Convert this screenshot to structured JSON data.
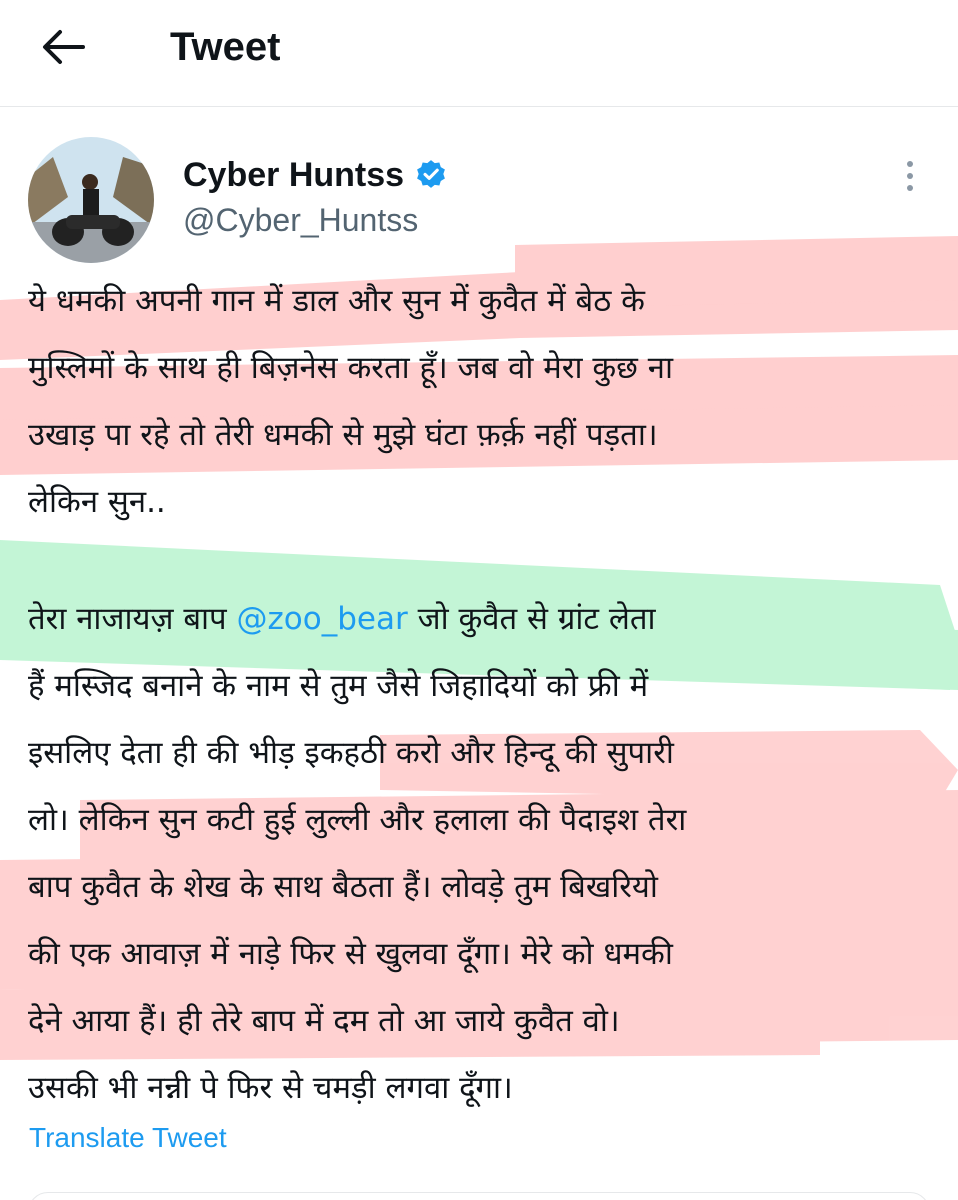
{
  "header": {
    "title": "Tweet",
    "back_icon": "arrow-left-icon"
  },
  "author": {
    "display_name": "Cyber Huntss",
    "handle": "@Cyber_Huntss",
    "verified_icon": "verified-badge-icon",
    "more_icon": "more-vertical-icon"
  },
  "tweet": {
    "lines": [
      "ये धमकी अपनी गान में डाल और सुन में कुवैत में बेठ के",
      "मुस्लिमों के साथ ही बिज़नेस करता हूँ। जब वो मेरा कुछ ना",
      "उखाड़ पा रहे तो तेरी धमकी से मुझे घंटा फ़र्क़ नहीं पड़ता।",
      "लेकिन सुन.."
    ],
    "para2_line1_before": "तेरा नाजायज़ बाप ",
    "mention": "@zoo_bear",
    "para2_line1_after": " जो कुवैत से ग्रांट लेता",
    "para2_lines": [
      "हैं मस्जिद बनाने के  नाम से तुम जैसे जिहादियों को फ्री में",
      "इसलिए देता ही की भीड़ इकहठी करो और हिन्दू की सुपारी",
      "लो। लेकिन सुन कटी हुई लुल्ली और हलाला की पैदाइश तेरा",
      "बाप कुवैत के शेख के साथ बैठता हैं। लोवड़े तुम बिखरियो",
      "की एक आवाज़ में नाड़े फिर से खुलवा दूँगा। मेरे को धमकी",
      "देने आया हैं। ही तेरे बाप में दम तो आ जाये कुवैत वो।",
      "उसकी भी नन्नी पे फिर से चमड़ी लगवा दूँगा।"
    ]
  },
  "translate_label": "Translate Tweet",
  "colors": {
    "accent": "#1d9bf0",
    "highlight_red": "#ff9a9a",
    "highlight_green": "#8df0b0",
    "text": "#0f1419",
    "secondary": "#536471"
  }
}
